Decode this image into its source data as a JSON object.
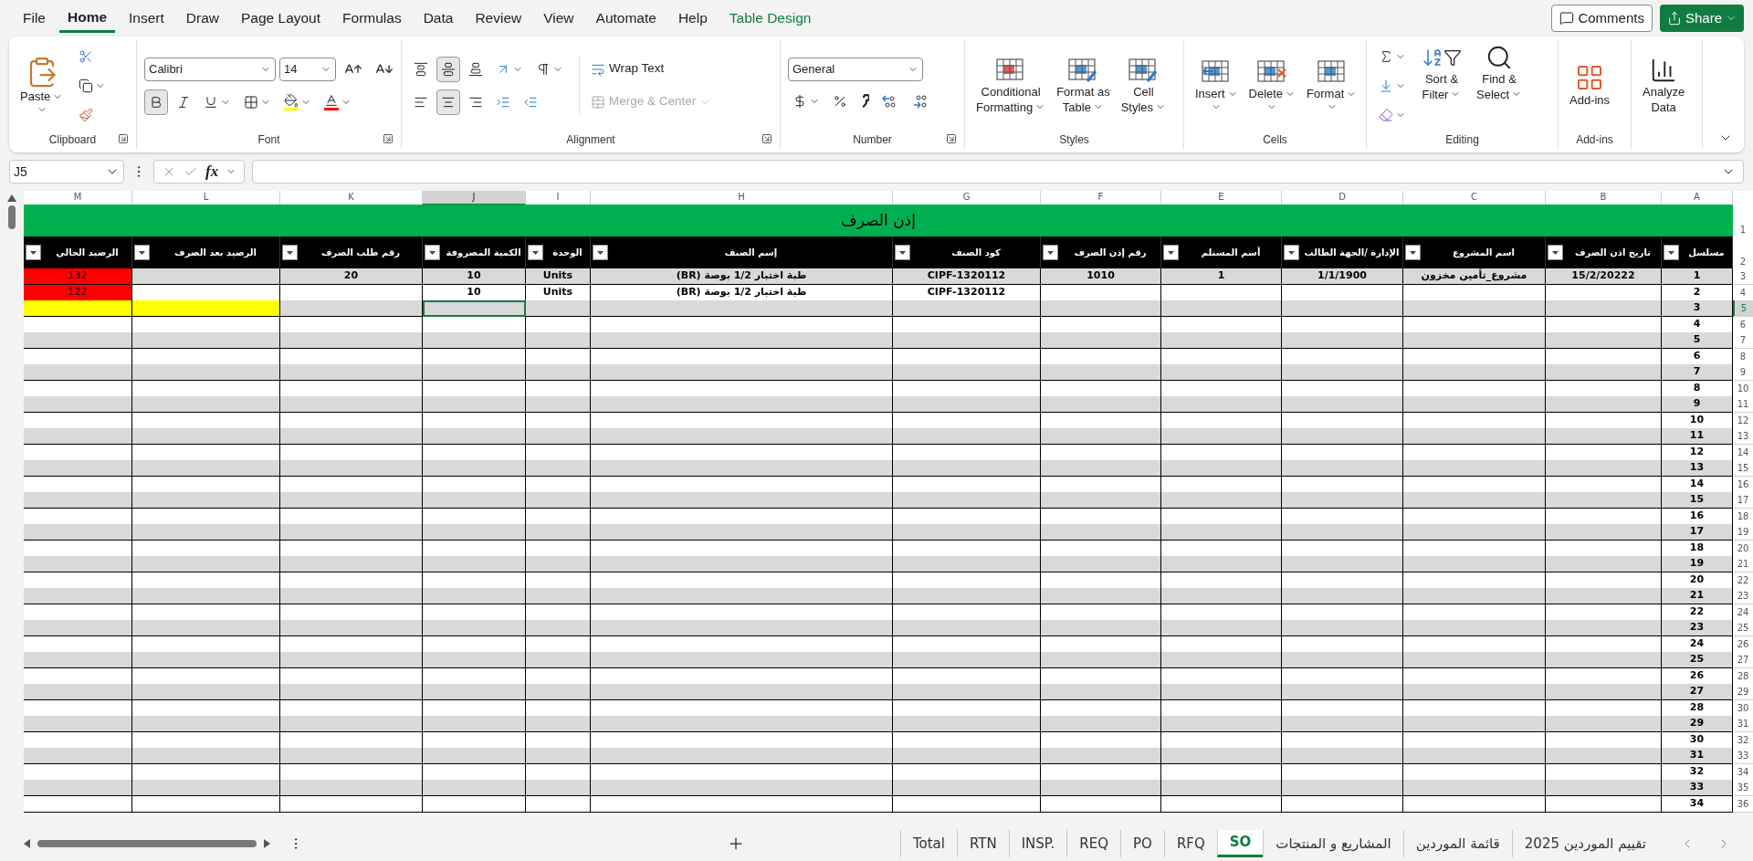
{
  "menu_tabs": [
    {
      "label": "File",
      "selected": false,
      "kind": "standard"
    },
    {
      "label": "Home",
      "selected": true,
      "kind": "standard"
    },
    {
      "label": "Insert",
      "selected": false,
      "kind": "standard"
    },
    {
      "label": "Draw",
      "selected": false,
      "kind": "standard"
    },
    {
      "label": "Page Layout",
      "selected": false,
      "kind": "standard"
    },
    {
      "label": "Formulas",
      "selected": false,
      "kind": "standard"
    },
    {
      "label": "Data",
      "selected": false,
      "kind": "standard"
    },
    {
      "label": "Review",
      "selected": false,
      "kind": "standard"
    },
    {
      "label": "View",
      "selected": false,
      "kind": "standard"
    },
    {
      "label": "Automate",
      "selected": false,
      "kind": "standard"
    },
    {
      "label": "Help",
      "selected": false,
      "kind": "standard"
    },
    {
      "label": "Table Design",
      "selected": false,
      "kind": "contextual"
    }
  ],
  "header_buttons": {
    "comments": "Comments",
    "share": "Share"
  },
  "ribbon": {
    "clipboard": {
      "paste": "Paste",
      "label": "Clipboard"
    },
    "font": {
      "family": "Calibri",
      "size": "14",
      "bold": true,
      "italic": false,
      "underline": false,
      "label": "Font"
    },
    "alignment": {
      "vertical": [
        {
          "selected": false
        },
        {
          "selected": true
        },
        {
          "selected": false
        }
      ],
      "horizontal": [
        {
          "selected": false
        },
        {
          "selected": true
        },
        {
          "selected": false
        }
      ],
      "wrap_text": "Wrap Text",
      "merge": {
        "label": "Merge & Center",
        "disabled": true
      },
      "label": "Alignment"
    },
    "number": {
      "format": "General",
      "label": "Number"
    },
    "styles": {
      "buttons": [
        {
          "lines": [
            "Conditional",
            "Formatting"
          ]
        },
        {
          "lines": [
            "Format as",
            "Table"
          ]
        },
        {
          "lines": [
            "Cell",
            "Styles"
          ]
        }
      ],
      "label": "Styles"
    },
    "cells": {
      "buttons": [
        "Insert",
        "Delete",
        "Format"
      ],
      "label": "Cells"
    },
    "editing": {
      "buttons": [
        {
          "lines": [
            "Sort &",
            "Filter"
          ]
        },
        {
          "lines": [
            "Find &",
            "Select"
          ]
        }
      ],
      "label": "Editing"
    },
    "addins": {
      "button": "Add-ins",
      "label": "Add-ins"
    },
    "analyze": {
      "lines": [
        "Analyze",
        "Data"
      ]
    }
  },
  "formula_bar": {
    "name_box": "J5",
    "function_label": "fx"
  },
  "sheet": {
    "title_row": "1",
    "title": "إذن الصرف",
    "header_row": "2",
    "columns": [
      {
        "letter": "M",
        "selected": false
      },
      {
        "letter": "L",
        "selected": false
      },
      {
        "letter": "K",
        "selected": false
      },
      {
        "letter": "J",
        "selected": true
      },
      {
        "letter": "I",
        "selected": false
      },
      {
        "letter": "H",
        "selected": false
      },
      {
        "letter": "G",
        "selected": false
      },
      {
        "letter": "F",
        "selected": false
      },
      {
        "letter": "E",
        "selected": false
      },
      {
        "letter": "D",
        "selected": false
      },
      {
        "letter": "C",
        "selected": false
      },
      {
        "letter": "B",
        "selected": false
      },
      {
        "letter": "A",
        "selected": false
      }
    ],
    "headers": [
      "مسلسل",
      "تاريخ اذن الصرف",
      "اسم المشروع",
      "الإدارة /الجهة الطالب",
      "أسم المستلم",
      "رقم إذن الصرف",
      "كود الصنف",
      "إسم الصنف",
      "الوحدة",
      "الكمية المصروفة",
      "رقم طلب الصرف",
      "الرصيد بعد الصرف",
      "الرصيد الحالي"
    ],
    "rows": [
      {
        "number": "3",
        "selected": false,
        "cells": {
          "M": {
            "text": "132",
            "color": "#ff0000"
          },
          "K": "20",
          "J": "10",
          "I": "Units",
          "H": "طبة اختبار 1/2 بوصة (BR)",
          "G": "CIPF-1320112",
          "F": "1010",
          "E": "1",
          "D": "1/1/1900",
          "C": "مشروع_تأمين مخزون",
          "B": "15/2/20222",
          "A": "1"
        }
      },
      {
        "number": "4",
        "selected": false,
        "cells": {
          "M": {
            "text": "122",
            "color": "#ff0000"
          },
          "J": "10",
          "I": "Units",
          "H": "طبة اختبار 1/2 بوصة (BR)",
          "G": "CIPF-1320112",
          "A": "2"
        }
      },
      {
        "number": "5",
        "selected": true,
        "cells": {
          "M": {
            "color": "#ffff00"
          },
          "L": {
            "color": "#ffff00"
          },
          "A": "3"
        }
      },
      {
        "number": "6",
        "selected": false,
        "cells": {
          "A": "4"
        }
      },
      {
        "number": "7",
        "selected": false,
        "cells": {
          "A": "5"
        }
      },
      {
        "number": "8",
        "selected": false,
        "cells": {
          "A": "6"
        }
      },
      {
        "number": "9",
        "selected": false,
        "cells": {
          "A": "7"
        }
      },
      {
        "number": "10",
        "selected": false,
        "cells": {
          "A": "8"
        }
      },
      {
        "number": "11",
        "selected": false,
        "cells": {
          "A": "9"
        }
      },
      {
        "number": "12",
        "selected": false,
        "cells": {
          "A": "10"
        }
      },
      {
        "number": "13",
        "selected": false,
        "cells": {
          "A": "11"
        }
      },
      {
        "number": "14",
        "selected": false,
        "cells": {
          "A": "12"
        }
      },
      {
        "number": "15",
        "selected": false,
        "cells": {
          "A": "13"
        }
      },
      {
        "number": "16",
        "selected": false,
        "cells": {
          "A": "14"
        }
      },
      {
        "number": "17",
        "selected": false,
        "cells": {
          "A": "15"
        }
      },
      {
        "number": "18",
        "selected": false,
        "cells": {
          "A": "16"
        }
      },
      {
        "number": "19",
        "selected": false,
        "cells": {
          "A": "17"
        }
      },
      {
        "number": "20",
        "selected": false,
        "cells": {
          "A": "18"
        }
      },
      {
        "number": "21",
        "selected": false,
        "cells": {
          "A": "19"
        }
      },
      {
        "number": "22",
        "selected": false,
        "cells": {
          "A": "20"
        }
      },
      {
        "number": "23",
        "selected": false,
        "cells": {
          "A": "21"
        }
      },
      {
        "number": "24",
        "selected": false,
        "cells": {
          "A": "22"
        }
      },
      {
        "number": "25",
        "selected": false,
        "cells": {
          "A": "23"
        }
      },
      {
        "number": "26",
        "selected": false,
        "cells": {
          "A": "24"
        }
      },
      {
        "number": "27",
        "selected": false,
        "cells": {
          "A": "25"
        }
      },
      {
        "number": "28",
        "selected": false,
        "cells": {
          "A": "26"
        }
      },
      {
        "number": "29",
        "selected": false,
        "cells": {
          "A": "27"
        }
      },
      {
        "number": "30",
        "selected": false,
        "cells": {
          "A": "28"
        }
      },
      {
        "number": "31",
        "selected": false,
        "cells": {
          "A": "29"
        }
      },
      {
        "number": "32",
        "selected": false,
        "cells": {
          "A": "30"
        }
      },
      {
        "number": "33",
        "selected": false,
        "cells": {
          "A": "31"
        }
      },
      {
        "number": "34",
        "selected": false,
        "cells": {
          "A": "32"
        }
      },
      {
        "number": "35",
        "selected": false,
        "cells": {
          "A": "33"
        }
      },
      {
        "number": "36",
        "selected": false,
        "cells": {
          "A": "34"
        }
      }
    ]
  },
  "sheet_tabs": [
    {
      "label": "Total",
      "selected": false
    },
    {
      "label": "RTN",
      "selected": false
    },
    {
      "label": "INSP.",
      "selected": false
    },
    {
      "label": "REQ",
      "selected": false
    },
    {
      "label": "PO",
      "selected": false
    },
    {
      "label": "RFQ",
      "selected": false
    },
    {
      "label": "SO",
      "selected": true
    },
    {
      "label": "المشاريع و المنتجات",
      "selected": false
    },
    {
      "label": "قائمة الموردين",
      "selected": false
    },
    {
      "label": "تقييم الموردين 2025",
      "selected": false
    }
  ]
}
